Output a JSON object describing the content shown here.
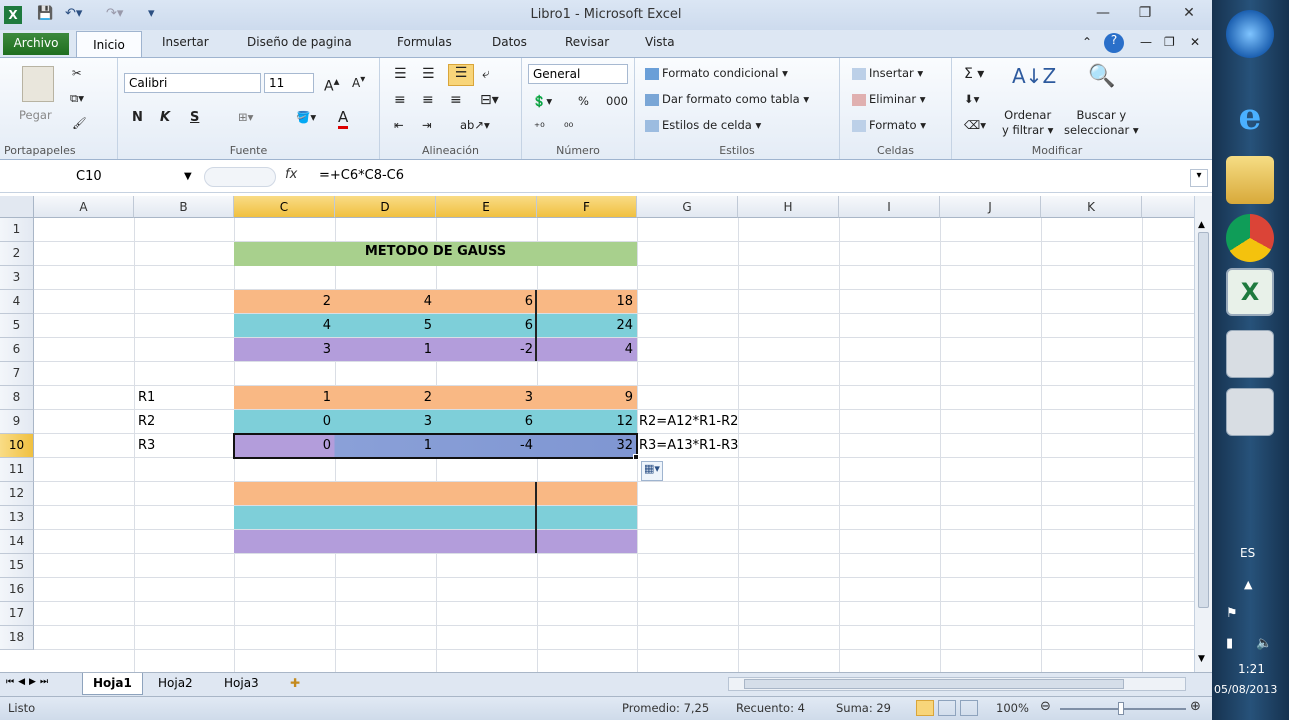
{
  "app": {
    "title": "Libro1 - Microsoft Excel"
  },
  "quick_access": {
    "save_icon": "save-icon",
    "undo_icon": "undo-icon",
    "redo_icon": "redo-icon"
  },
  "tabs": [
    "Archivo",
    "Inicio",
    "Insertar",
    "Diseño de pagina",
    "Formulas",
    "Datos",
    "Revisar",
    "Vista"
  ],
  "ribbon": {
    "clipboard": {
      "paste": "Pegar",
      "label": "Portapapeles"
    },
    "font": {
      "name": "Calibri",
      "size": "11",
      "bold": "N",
      "italic": "K",
      "underline": "S",
      "label": "Fuente"
    },
    "alignment": {
      "label": "Alineación"
    },
    "number": {
      "format": "General",
      "percent": "%",
      "thousands": "000",
      "label": "Número"
    },
    "styles": {
      "conditional": "Formato condicional",
      "table": "Dar formato como tabla",
      "cell": "Estilos de celda",
      "label": "Estilos"
    },
    "cells": {
      "insert": "Insertar",
      "delete": "Eliminar",
      "format": "Formato",
      "label": "Celdas"
    },
    "editing": {
      "sigma": "Σ",
      "sort1": "Ordenar",
      "sort2": "y filtrar",
      "find1": "Buscar y",
      "find2": "seleccionar",
      "label": "Modificar"
    }
  },
  "formula_bar": {
    "name_box": "C10",
    "fx": "fx",
    "formula": "=+C6*C8-C6"
  },
  "columns": [
    "A",
    "B",
    "C",
    "D",
    "E",
    "F",
    "G",
    "H",
    "I",
    "J",
    "K"
  ],
  "rows": [
    "1",
    "2",
    "3",
    "4",
    "5",
    "6",
    "7",
    "8",
    "9",
    "10",
    "11",
    "12",
    "13",
    "14",
    "15",
    "16",
    "17",
    "18"
  ],
  "sheet": {
    "title": "METODO DE GAUSS",
    "r4": [
      "2",
      "4",
      "6",
      "18"
    ],
    "r5": [
      "4",
      "5",
      "6",
      "24"
    ],
    "r6": [
      "3",
      "1",
      "-2",
      "4"
    ],
    "r8": [
      "1",
      "2",
      "3",
      "9"
    ],
    "r9": [
      "0",
      "3",
      "6",
      "12"
    ],
    "r10": [
      "0",
      "1",
      "-4",
      "32"
    ],
    "labels": [
      "R1",
      "R2",
      "R3"
    ],
    "notes": [
      "R2=A12*R1-R2",
      "R3=A13*R1-R3"
    ],
    "colors": {
      "orange": "#f9b884",
      "teal": "#7ecfd9",
      "purple": "#b39ddb",
      "green": "#a8d08d"
    }
  },
  "sheet_tabs": [
    "Hoja1",
    "Hoja2",
    "Hoja3"
  ],
  "status": {
    "mode": "Listo",
    "avg": "Promedio: 7,25",
    "count": "Recuento: 4",
    "sum": "Suma: 29",
    "zoom": "100%"
  },
  "taskbar": {
    "lang": "ES",
    "time": "1:21",
    "date": "05/08/2013"
  }
}
